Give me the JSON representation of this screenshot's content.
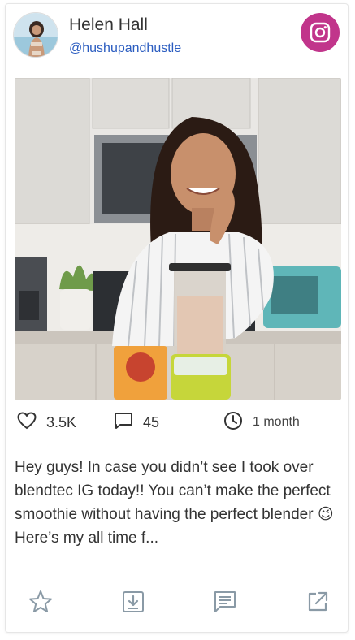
{
  "post": {
    "author_name": "Helen Hall",
    "author_handle": "@hushupandhustle",
    "network_icon": "instagram-icon",
    "network_color": "#c1358b",
    "likes": "3.5K",
    "comments": "45",
    "posted_ago": "1 month",
    "caption": "Hey guys! In case you didn’t see I took over blendtec IG today!! You can’t make the perfect smoothie without having the perfect blender 😉 Here’s my all time f..."
  },
  "icons": {
    "like": "heart-icon",
    "comment": "comment-icon",
    "time": "clock-icon",
    "favorite": "star-icon",
    "download": "download-icon",
    "message": "message-icon",
    "open": "external-link-icon"
  },
  "colors": {
    "handle": "#2a5cc0",
    "action_icons": "#8a9aa6",
    "stat_icons": "#333333"
  }
}
